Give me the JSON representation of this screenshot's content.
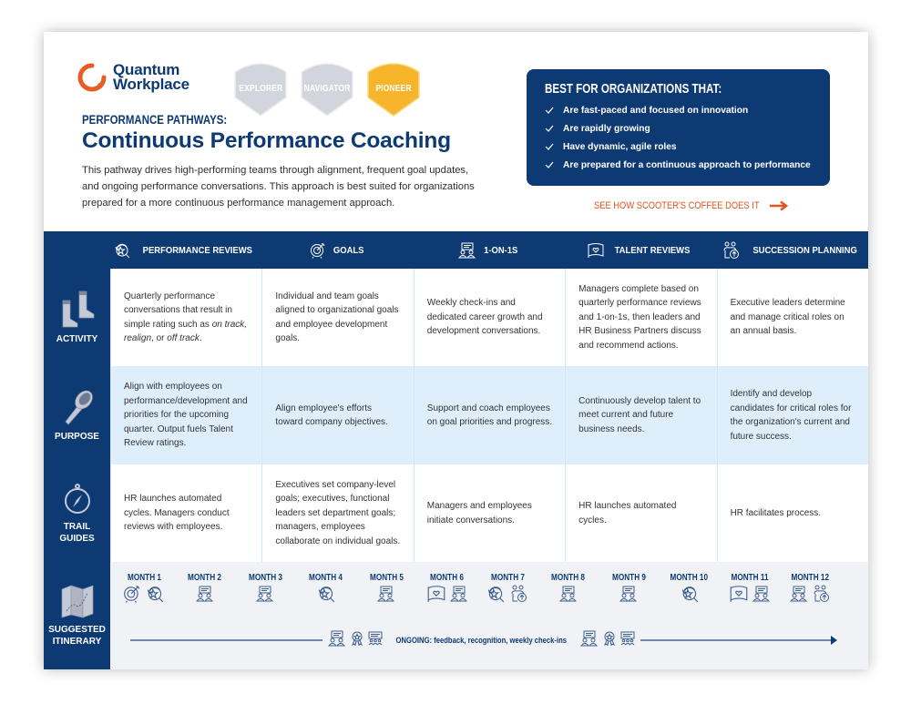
{
  "brand": {
    "name_line1": "Quantum",
    "name_line2": "Workplace",
    "logo_color": "#e85d26",
    "primary_color": "#0d3a73",
    "accent_orange": "#e0561f",
    "pioneer_color": "#f6b52a",
    "inactive_badge_color": "#d3d5dc"
  },
  "badges": [
    {
      "label": "EXPLORER",
      "active": false
    },
    {
      "label": "NAVIGATOR",
      "active": false
    },
    {
      "label": "PIONEER",
      "active": true
    }
  ],
  "header": {
    "kicker": "PERFORMANCE PATHWAYS:",
    "title": "Continuous Performance Coaching",
    "intro": "This pathway drives high-performing teams through alignment, frequent goal updates, and ongoing performance conversations. This approach is best suited for organizations prepared for a more continuous performance management approach."
  },
  "best_for": {
    "title": "BEST FOR ORGANIZATIONS THAT:",
    "items": [
      "Are fast-paced and focused on innovation",
      "Are rapidly growing",
      "Have dynamic, agile roles",
      "Are prepared for a continuous approach to performance"
    ],
    "check_icon": "checkmark-icon"
  },
  "cta": {
    "label": "SEE HOW SCOOTER'S COFFEE DOES IT",
    "icon": "arrow-right-icon"
  },
  "table": {
    "columns": [
      {
        "label": "PERFORMANCE REVIEWS",
        "icon": "performance-review-icon"
      },
      {
        "label": "GOALS",
        "icon": "goal-target-icon"
      },
      {
        "label": "1-ON-1S",
        "icon": "one-on-one-icon"
      },
      {
        "label": "TALENT REVIEWS",
        "icon": "talent-review-flag-icon"
      },
      {
        "label": "SUCCESSION PLANNING",
        "icon": "succession-planning-icon"
      }
    ],
    "rows": [
      {
        "label": "ACTIVITY",
        "icon": "boots-icon",
        "cells": [
          "Quarterly performance conversations that result in simple rating such as on track, realign, or off track.",
          "Individual and team goals aligned to organizational goals and employee development goals.",
          "Weekly check-ins and dedicated career growth and development conversations.",
          "Managers complete based on quarterly performance reviews and 1-on-1s, then leaders and HR Business Partners discuss and recommend actions.",
          "Executive leaders determine and manage critical roles on an annual basis."
        ],
        "cell0_parts": {
          "pre": "Quarterly performance conversations that result in simple rating such as ",
          "i1": "on track,",
          "mid1": " ",
          "i2": "realign",
          "mid2": ", or ",
          "i3": "off track",
          "post": "."
        }
      },
      {
        "label": "PURPOSE",
        "icon": "flashlight-icon",
        "cells": [
          "Align with employees on performance/development and priorities for the upcoming quarter. Output fuels Talent Review ratings.",
          "Align employee's efforts toward company objectives.",
          "Support and coach employees on goal priorities and progress.",
          "Continuously develop talent to meet current and future business needs.",
          "Identify and develop candidates for critical roles for the organization's current and future success."
        ]
      },
      {
        "label_line1": "TRAIL",
        "label_line2": "GUIDES",
        "icon": "compass-icon",
        "cells": [
          "HR launches automated cycles. Managers conduct reviews with employees.",
          "Executives set company-level goals; executives, functional leaders set department goals; managers, employees collaborate on individual goals.",
          "Managers and employees initiate conversations.",
          "HR launches automated cycles.",
          "HR facilitates process."
        ]
      }
    ],
    "itinerary": {
      "label_line1": "SUGGESTED",
      "label_line2": "ITINERARY",
      "icon": "map-icon",
      "months": [
        {
          "label": "MONTH 1",
          "icons": [
            "goal",
            "review"
          ]
        },
        {
          "label": "MONTH 2",
          "icons": [
            "oneonone"
          ]
        },
        {
          "label": "MONTH 3",
          "icons": [
            "oneonone"
          ]
        },
        {
          "label": "MONTH 4",
          "icons": [
            "review"
          ]
        },
        {
          "label": "MONTH 5",
          "icons": [
            "oneonone"
          ]
        },
        {
          "label": "MONTH 6",
          "icons": [
            "talent",
            "oneonone"
          ]
        },
        {
          "label": "MONTH 7",
          "icons": [
            "review",
            "succession"
          ]
        },
        {
          "label": "MONTH 8",
          "icons": [
            "oneonone"
          ]
        },
        {
          "label": "MONTH 9",
          "icons": [
            "oneonone"
          ]
        },
        {
          "label": "MONTH 10",
          "icons": [
            "review"
          ]
        },
        {
          "label": "MONTH 11",
          "icons": [
            "talent",
            "oneonone"
          ]
        },
        {
          "label": "MONTH 12",
          "icons": [
            "oneonone",
            "succession"
          ]
        }
      ],
      "ongoing": "ONGOING: feedback, recognition, weekly check-ins"
    }
  }
}
